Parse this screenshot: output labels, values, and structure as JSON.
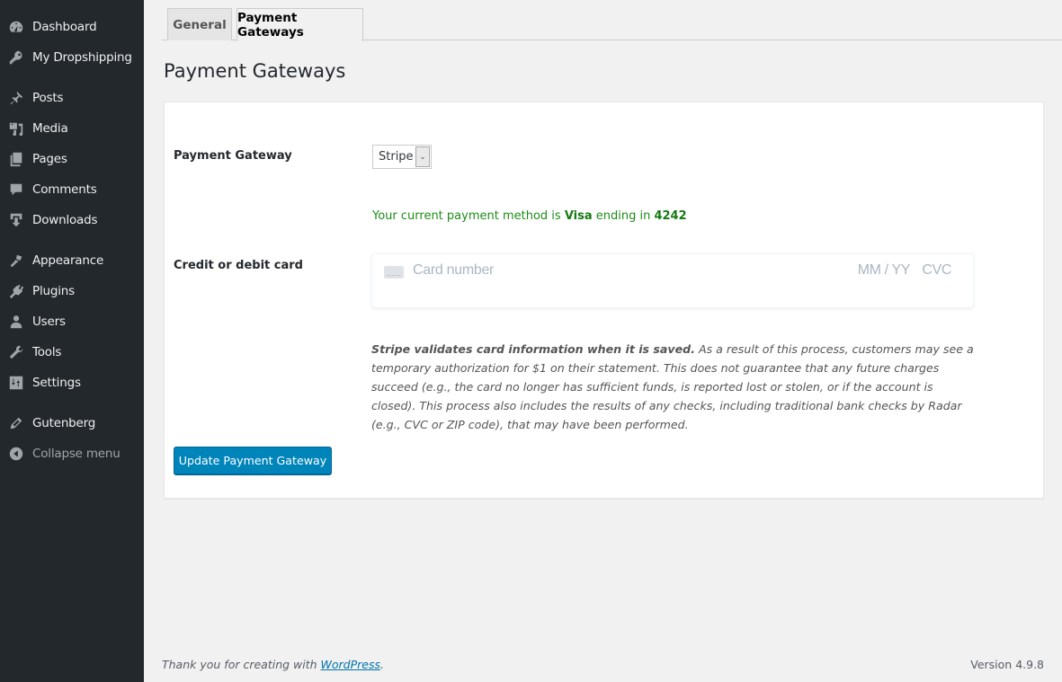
{
  "sidebar": {
    "items": [
      {
        "label": "Dashboard",
        "icon": "dashboard-icon"
      },
      {
        "label": "My Dropshipping",
        "icon": "key-icon"
      },
      {
        "label": "Posts",
        "icon": "pushpin-icon"
      },
      {
        "label": "Media",
        "icon": "media-icon"
      },
      {
        "label": "Pages",
        "icon": "pages-icon"
      },
      {
        "label": "Comments",
        "icon": "comment-icon"
      },
      {
        "label": "Downloads",
        "icon": "download-icon"
      },
      {
        "label": "Appearance",
        "icon": "paintbrush-icon"
      },
      {
        "label": "Plugins",
        "icon": "plugin-icon"
      },
      {
        "label": "Users",
        "icon": "user-icon"
      },
      {
        "label": "Tools",
        "icon": "wrench-icon"
      },
      {
        "label": "Settings",
        "icon": "settings-icon"
      },
      {
        "label": "Gutenberg",
        "icon": "pencil-icon"
      }
    ],
    "collapse_label": "Collapse menu"
  },
  "tabs": [
    {
      "label": "General",
      "active": false
    },
    {
      "label": "Payment Gateways",
      "active": true
    }
  ],
  "page_title": "Payment Gateways",
  "form": {
    "gateway_label": "Payment Gateway",
    "gateway_value": "Stripe",
    "payment_note": {
      "prefix": "Your current payment method is ",
      "brand": "Visa",
      "middle": " ending in ",
      "last4": "4242"
    },
    "card_label": "Credit or debit card",
    "card_number_placeholder": "Card number",
    "card_exp_placeholder": "MM / YY",
    "card_cvc_placeholder": "CVC",
    "disclaimer_bold": "Stripe validates card information when it is saved.",
    "disclaimer_rest": " As a result of this process, customers may see a temporary authorization for $1 on their statement. This does not guarantee that any future charges succeed (e.g., the card no longer has sufficient funds, is reported lost or stolen, or if the account is closed). This process also includes the results of any checks, including traditional bank checks by Radar (e.g., CVC or ZIP code), that may have been performed.",
    "submit_label": "Update Payment Gateway"
  },
  "footer": {
    "thanks_prefix": "Thank you for creating with ",
    "thanks_link": "WordPress",
    "thanks_suffix": ".",
    "version": "Version 4.9.8"
  },
  "colors": {
    "sidebar_bg": "#23282d",
    "primary_button": "#0085ba",
    "success_text": "#1e8c19",
    "link": "#0073aa"
  }
}
